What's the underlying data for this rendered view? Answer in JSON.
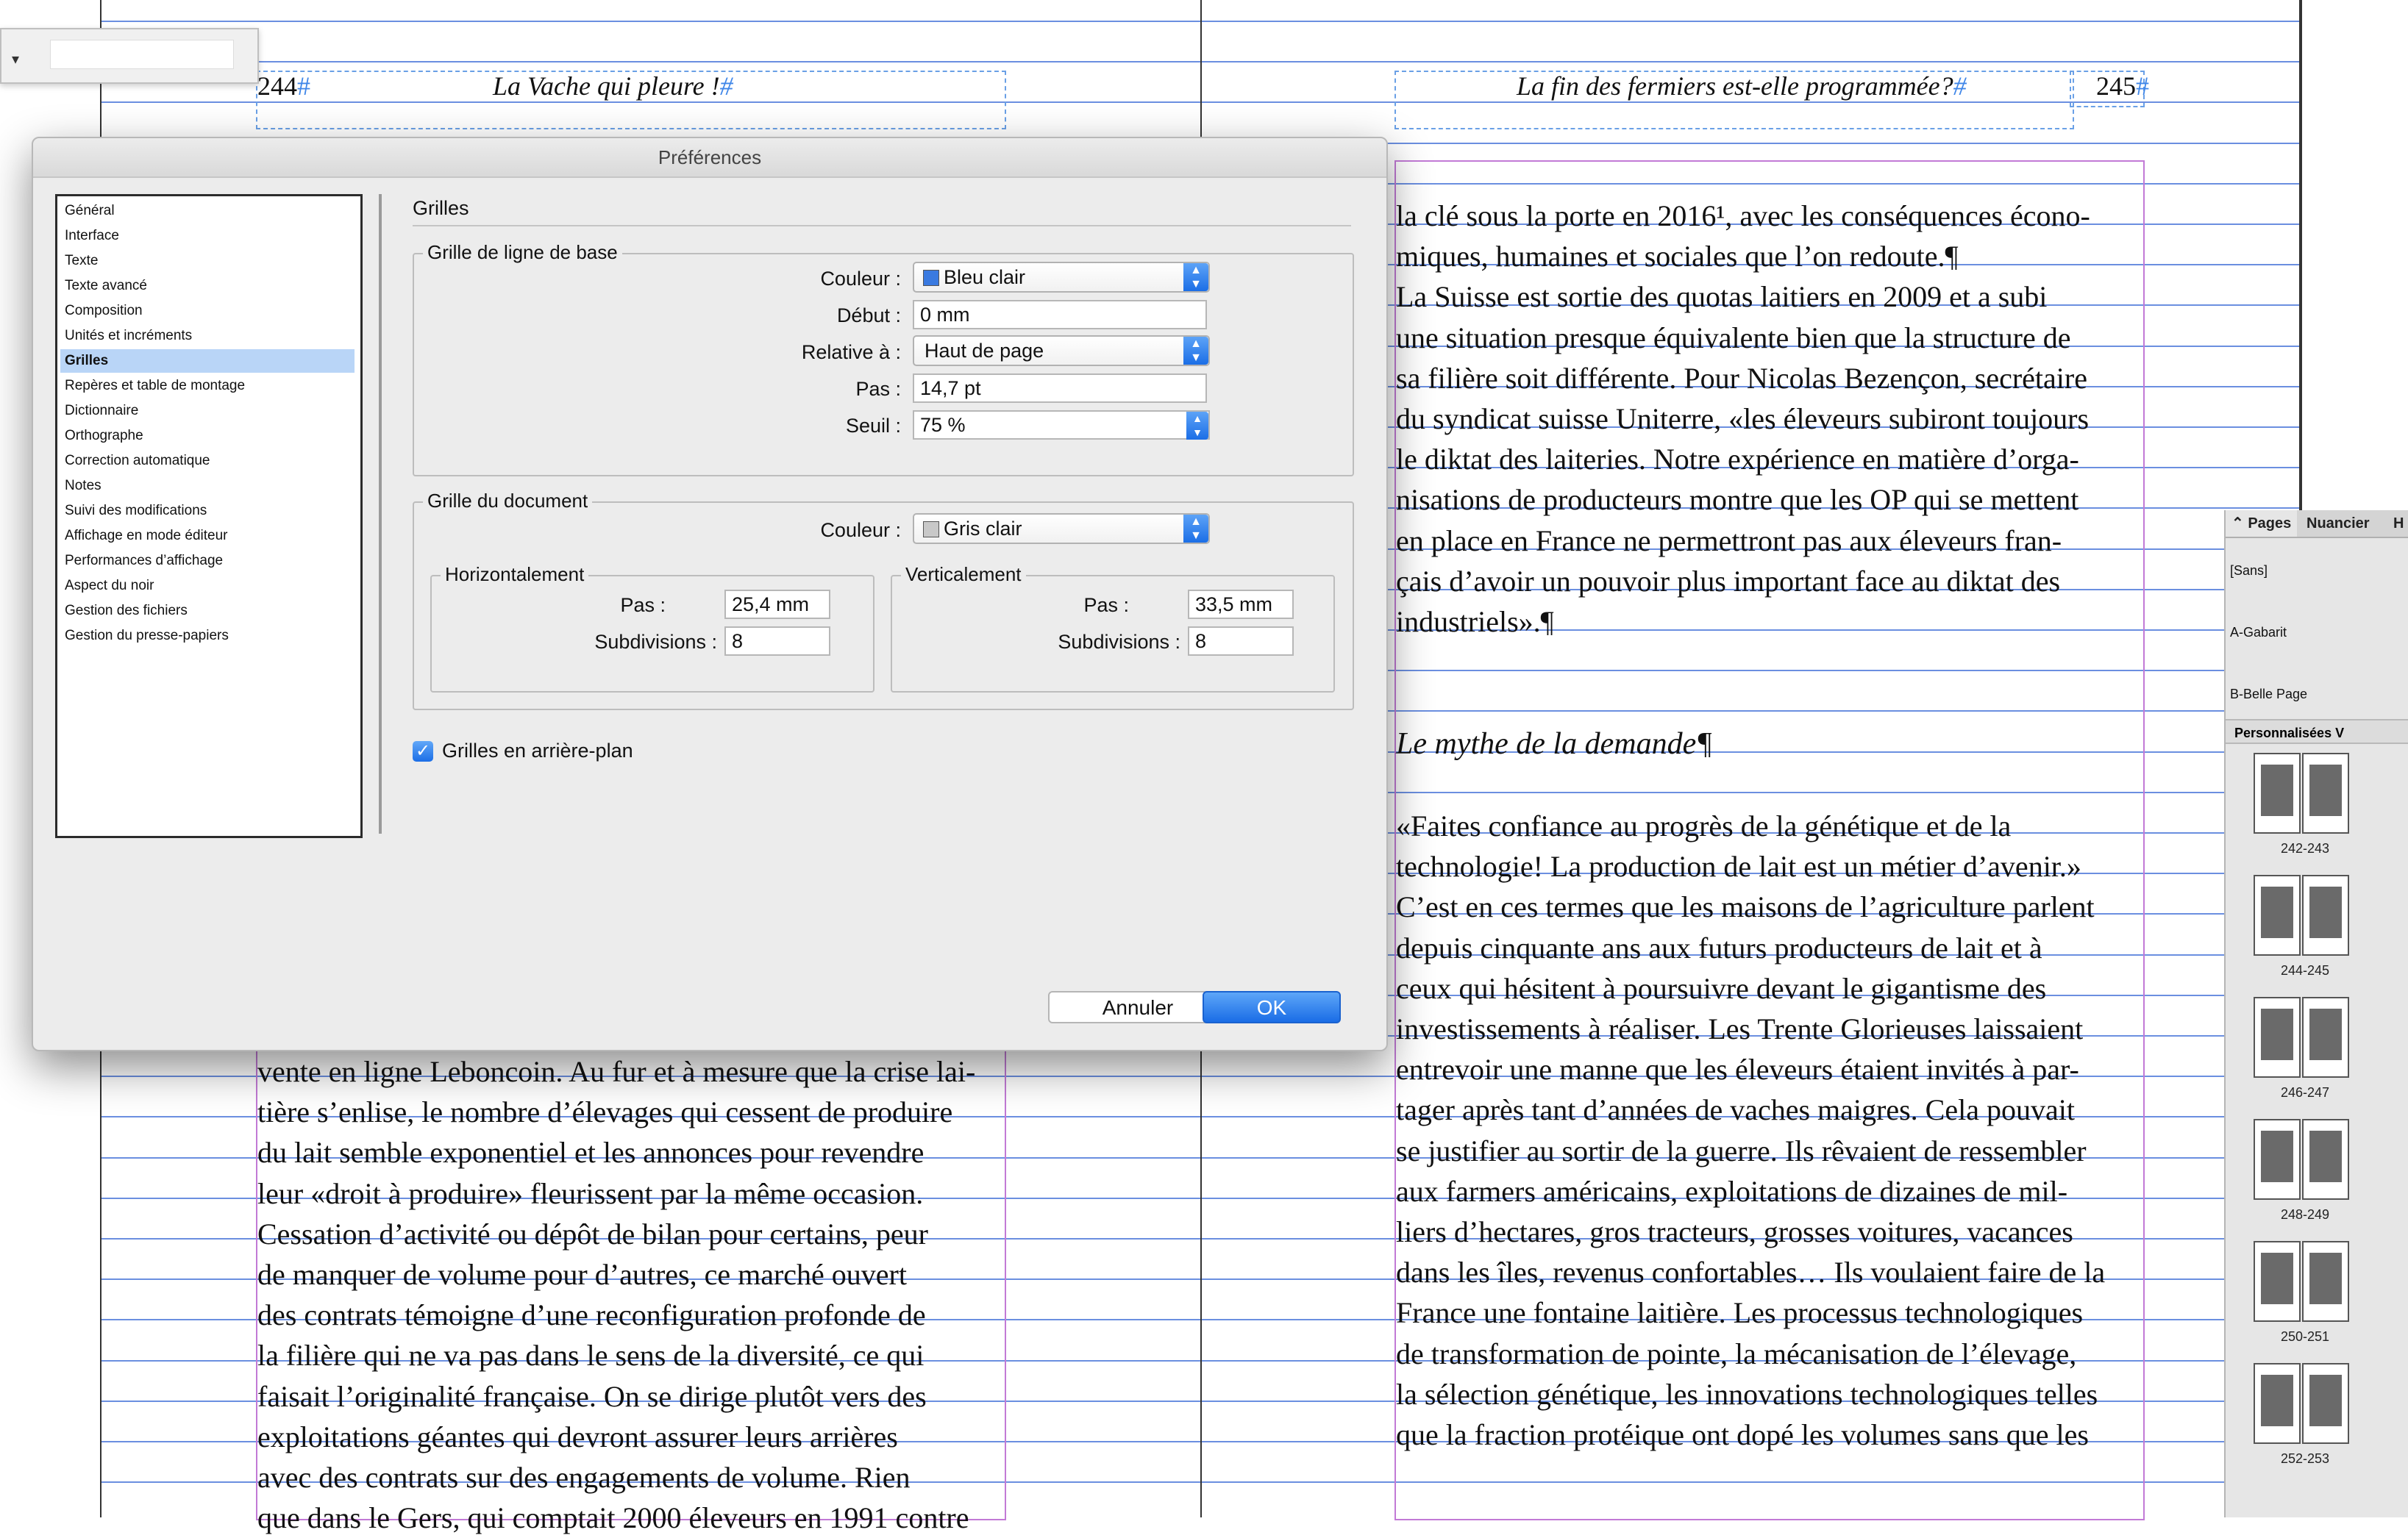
{
  "document": {
    "left_page": {
      "page_number": "244",
      "running_head": "La Vache qui pleure !",
      "lines": [
        "vente en ligne Leboncoin. Au fur et à mesure que la crise lai-",
        "tière s’enlise, le nombre d’élevages qui cessent de produire",
        "du lait semble exponentiel et les annonces pour revendre",
        "leur «droit à produire» fleurissent par la même occasion.",
        "Cessation d’activité ou dépôt de bilan pour certains, peur",
        "de manquer de volume pour d’autres, ce marché ouvert",
        "des contrats témoigne d’une reconfiguration profonde de",
        "la filière qui ne va pas dans le sens de la diversité, ce qui",
        "faisait l’originalité française. On se dirige plutôt vers des",
        "exploitations géantes qui devront assurer leurs arrières",
        "avec des contrats sur des engagements de volume. Rien",
        "que dans le Gers, qui comptait 2000 éleveurs en 1991 contre"
      ]
    },
    "right_page": {
      "page_number": "245",
      "running_head": "La fin des fermiers est-elle programmée?",
      "para1": [
        "la clé sous la porte en 2016¹, avec les conséquences écono-",
        "miques, humaines et sociales que l’on redoute.¶",
        "La Suisse est sortie des quotas laitiers en 2009 et a subi",
        "une situation presque équivalente bien que la structure de",
        "sa filière soit différente. Pour Nicolas Bezençon, secrétaire",
        "du syndicat suisse Uniterre, «les éleveurs subiront toujours",
        "le diktat des laiteries. Notre expérience en matière d’orga-",
        "nisations de producteurs montre que les OP qui se mettent",
        "en place en France ne permettront pas aux éleveurs fran-",
        "çais d’avoir un pouvoir plus important face au diktat des",
        "industriels».¶"
      ],
      "heading": "Le mythe de la demande¶",
      "para2": [
        "«Faites confiance au progrès de la génétique et de la",
        "technologie! La production de lait est un métier d’avenir.»",
        "C’est en ces termes que les maisons de l’agriculture parlent",
        "depuis cinquante ans aux futurs producteurs de lait et à",
        "ceux qui hésitent à poursuivre devant le gigantisme des",
        "investissements à réaliser. Les Trente Glorieuses laissaient",
        "entrevoir une manne que les éleveurs étaient invités à par-",
        "tager après tant d’années de vaches maigres. Cela pouvait",
        "se justifier au sortir de la guerre. Ils rêvaient de ressembler",
        "aux farmers américains, exploitations de dizaines de mil-",
        "liers d’hectares, gros tracteurs, grosses voitures, vacances",
        "dans les îles, revenus confortables… Ils voulaient faire de la",
        "France une fontaine laitière. Les processus technologiques",
        "de transformation de pointe, la mécanisation de l’élevage,",
        "la sélection génétique, les innovations technologiques telles",
        "que la fraction protéique ont dopé les volumes sans que les"
      ]
    }
  },
  "dialog": {
    "title": "Préférences",
    "categories": [
      "Général",
      "Interface",
      "Texte",
      "Texte avancé",
      "Composition",
      "Unités et incréments",
      "Grilles",
      "Repères et table de montage",
      "Dictionnaire",
      "Orthographe",
      "Correction automatique",
      "Notes",
      "Suivi des modifications",
      "Affichage en mode éditeur",
      "Performances d’affichage",
      "Aspect du noir",
      "Gestion des fichiers",
      "Gestion du presse-papiers"
    ],
    "selected_category": "Grilles",
    "section_title": "Grilles",
    "baseline": {
      "group_label": "Grille de ligne de base",
      "color_label": "Couleur :",
      "color_value": "Bleu clair",
      "color_hex": "#3a7ae0",
      "start_label": "Début :",
      "start_value": "0 mm",
      "relative_label": "Relative à :",
      "relative_value": "Haut de page",
      "increment_label": "Pas :",
      "increment_value": "14,7 pt",
      "threshold_label": "Seuil :",
      "threshold_value": "75 %"
    },
    "document_grid": {
      "group_label": "Grille du document",
      "color_label": "Couleur :",
      "color_value": "Gris clair",
      "color_hex": "#c8c8c8",
      "horizontal": {
        "label": "Horizontalement",
        "step_label": "Pas :",
        "step_value": "25,4 mm",
        "subdiv_label": "Subdivisions :",
        "subdiv_value": "8"
      },
      "vertical": {
        "label": "Verticalement",
        "step_label": "Pas :",
        "step_value": "33,5 mm",
        "subdiv_label": "Subdivisions :",
        "subdiv_value": "8"
      }
    },
    "background_checkbox_label": "Grilles en arrière-plan",
    "background_checked": true,
    "cancel_label": "Annuler",
    "ok_label": "OK"
  },
  "pages_panel": {
    "tabs": [
      "Pages",
      "Nuancier",
      "H"
    ],
    "masters": [
      "[Sans]",
      "A-Gabarit",
      "B-Belle Page"
    ],
    "size_menu": "Personnalisées V",
    "spreads": [
      "242-243",
      "244-245",
      "246-247",
      "248-249",
      "250-251",
      "252-253"
    ]
  },
  "colors": {
    "accent_blue": "#1a6de6",
    "baseline_grid": "#6b8fe0",
    "frame_magenta": "#c27ad6"
  }
}
